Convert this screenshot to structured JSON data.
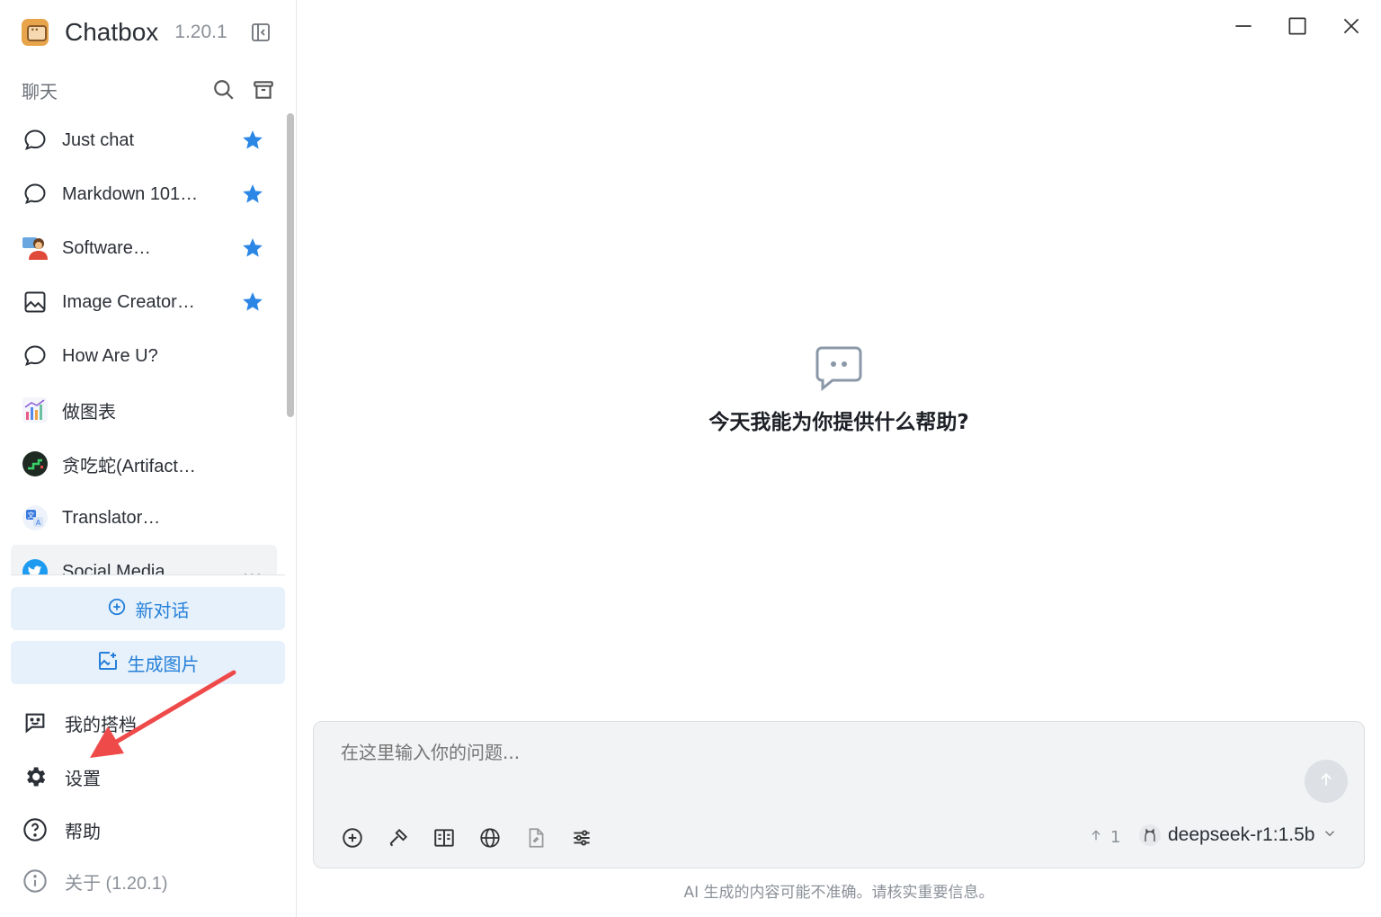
{
  "app": {
    "name": "Chatbox",
    "version": "1.20.1"
  },
  "sidebar": {
    "section_title": "聊天",
    "sessions": [
      {
        "label": "Just chat",
        "icon": "chat-bubble-icon",
        "starred": true
      },
      {
        "label": "Markdown 101…",
        "icon": "chat-bubble-icon",
        "starred": true
      },
      {
        "label": "Software…",
        "icon": "developer-avatar-icon",
        "starred": true
      },
      {
        "label": "Image Creator…",
        "icon": "image-icon",
        "starred": true
      },
      {
        "label": "How Are U?",
        "icon": "chat-bubble-icon",
        "starred": false
      },
      {
        "label": "做图表",
        "icon": "chart-avatar-icon",
        "starred": false
      },
      {
        "label": "贪吃蛇(Artifact…",
        "icon": "snake-avatar-icon",
        "starred": false
      },
      {
        "label": "Translator…",
        "icon": "translate-avatar-icon",
        "starred": false
      },
      {
        "label": "Social Media…",
        "icon": "twitter-avatar-icon",
        "starred": false
      }
    ],
    "new_chat_label": "新对话",
    "gen_image_label": "生成图片",
    "nav": {
      "copilots": "我的搭档",
      "settings": "设置",
      "help": "帮助",
      "about": "关于 (1.20.1)"
    }
  },
  "main": {
    "welcome": "今天我能为你提供什么帮助?",
    "input_placeholder": "在这里输入你的问题...",
    "context_count": "1",
    "model": "deepseek-r1:1.5b",
    "disclaimer": "AI 生成的内容可能不准确。请核实重要信息。"
  },
  "colors": {
    "accent": "#2680d9",
    "star": "#2b86e6",
    "annotation_arrow": "#ef4a4a"
  }
}
